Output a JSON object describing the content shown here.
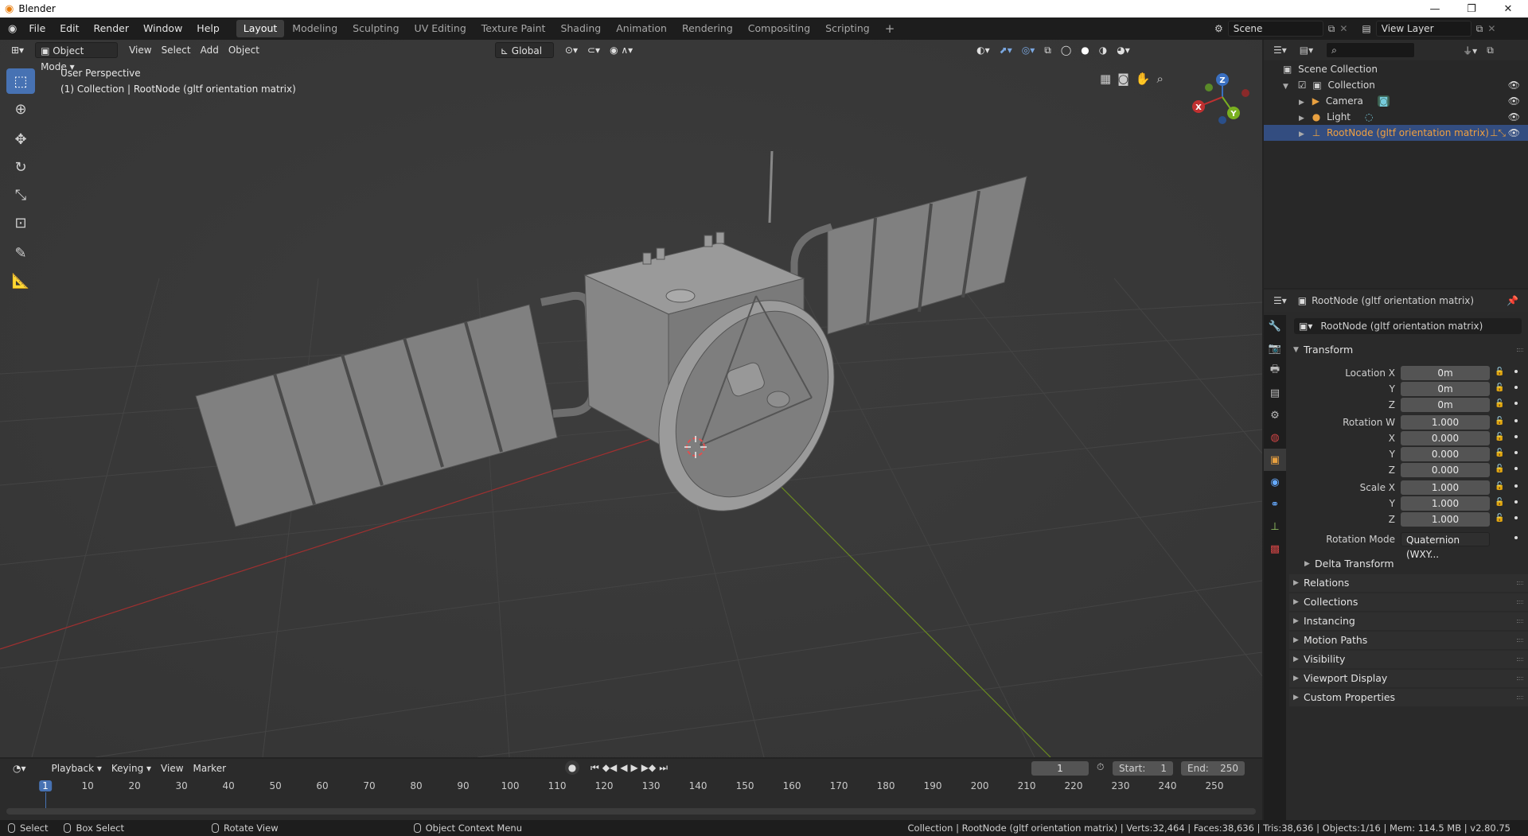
{
  "window": {
    "title": "Blender",
    "controls": [
      "—",
      "❐",
      "✕"
    ]
  },
  "menu": [
    "File",
    "Edit",
    "Render",
    "Window",
    "Help"
  ],
  "workspaces": [
    {
      "label": "Layout",
      "active": true
    },
    {
      "label": "Modeling"
    },
    {
      "label": "Sculpting"
    },
    {
      "label": "UV Editing"
    },
    {
      "label": "Texture Paint"
    },
    {
      "label": "Shading"
    },
    {
      "label": "Animation"
    },
    {
      "label": "Rendering"
    },
    {
      "label": "Compositing"
    },
    {
      "label": "Scripting"
    }
  ],
  "topright": {
    "scene": "Scene",
    "view_layer": "View Layer"
  },
  "viewport": {
    "mode": "Object Mode",
    "menus": [
      "View",
      "Select",
      "Add",
      "Object"
    ],
    "orientation": "Global",
    "overlay_title": "User Perspective",
    "overlay_subtitle": "(1) Collection | RootNode (gltf orientation matrix)",
    "gizmo": {
      "x": "X",
      "y": "Y",
      "z": "Z"
    },
    "colors": {
      "bg": "#3a3a3a",
      "grid": "#444444",
      "x_axis": "#a03030",
      "y_axis": "#6a8a20"
    }
  },
  "outliner": {
    "root": "Scene Collection",
    "items": [
      {
        "label": "Collection"
      },
      {
        "label": "Camera"
      },
      {
        "label": "Light"
      },
      {
        "label": "RootNode (gltf orientation matrix)"
      }
    ]
  },
  "properties": {
    "header_object": "RootNode (gltf orientation matrix)",
    "object_name": "RootNode (gltf orientation matrix)",
    "transform": {
      "title": "Transform",
      "rows": [
        {
          "label": "Location X",
          "value": "0m"
        },
        {
          "label": "Y",
          "value": "0m"
        },
        {
          "label": "Z",
          "value": "0m"
        },
        {
          "label": "Rotation W",
          "value": "1.000"
        },
        {
          "label": "X",
          "value": "0.000"
        },
        {
          "label": "Y",
          "value": "0.000"
        },
        {
          "label": "Z",
          "value": "0.000"
        },
        {
          "label": "Scale X",
          "value": "1.000"
        },
        {
          "label": "Y",
          "value": "1.000"
        },
        {
          "label": "Z",
          "value": "1.000"
        }
      ],
      "rotation_mode_label": "Rotation Mode",
      "rotation_mode_value": "Quaternion (WXY..."
    },
    "delta_transform": "Delta Transform",
    "panels": [
      "Relations",
      "Collections",
      "Instancing",
      "Motion Paths",
      "Visibility",
      "Viewport Display",
      "Custom Properties"
    ]
  },
  "timeline": {
    "menus": [
      "Playback",
      "Keying",
      "View",
      "Marker"
    ],
    "current_frame": "1",
    "start_label": "Start:",
    "start_value": "1",
    "end_label": "End:",
    "end_value": "250",
    "ticks": [
      "1",
      "10",
      "20",
      "30",
      "40",
      "50",
      "60",
      "70",
      "80",
      "90",
      "100",
      "110",
      "120",
      "130",
      "140",
      "150",
      "160",
      "170",
      "180",
      "190",
      "200",
      "210",
      "220",
      "230",
      "240",
      "250"
    ]
  },
  "statusbar": {
    "select": "Select",
    "box_select": "Box Select",
    "rotate_view": "Rotate View",
    "context_menu": "Object Context Menu",
    "stats": "Collection | RootNode (gltf orientation matrix) | Verts:32,464 | Faces:38,636 | Tris:38,636 | Objects:1/16 | Mem: 114.5 MB | v2.80.75"
  }
}
